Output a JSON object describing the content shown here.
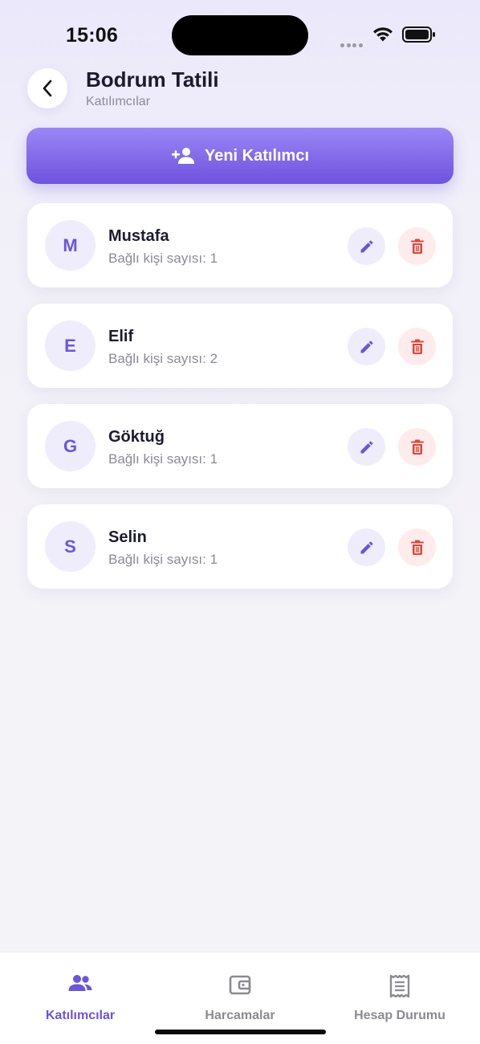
{
  "status_bar": {
    "time": "15:06"
  },
  "header": {
    "title": "Bodrum Tatili",
    "subtitle": "Katılımcılar"
  },
  "actions": {
    "new_participant_label": "Yeni Katılımcı"
  },
  "participants": [
    {
      "initial": "M",
      "name": "Mustafa",
      "meta": "Bağlı kişi sayısı: 1"
    },
    {
      "initial": "E",
      "name": "Elif",
      "meta": "Bağlı kişi sayısı: 2"
    },
    {
      "initial": "G",
      "name": "Göktuğ",
      "meta": "Bağlı kişi sayısı: 1"
    },
    {
      "initial": "S",
      "name": "Selin",
      "meta": "Bağlı kişi sayısı: 1"
    }
  ],
  "tabs": [
    {
      "label": "Katılımcılar",
      "icon": "people-icon",
      "active": true
    },
    {
      "label": "Harcamalar",
      "icon": "wallet-icon",
      "active": false
    },
    {
      "label": "Hesap Durumu",
      "icon": "receipt-icon",
      "active": false
    }
  ],
  "colors": {
    "accent": "#6c55d8",
    "accent_light": "#efedfc",
    "danger": "#e0453a",
    "danger_light": "#fdeceb"
  }
}
